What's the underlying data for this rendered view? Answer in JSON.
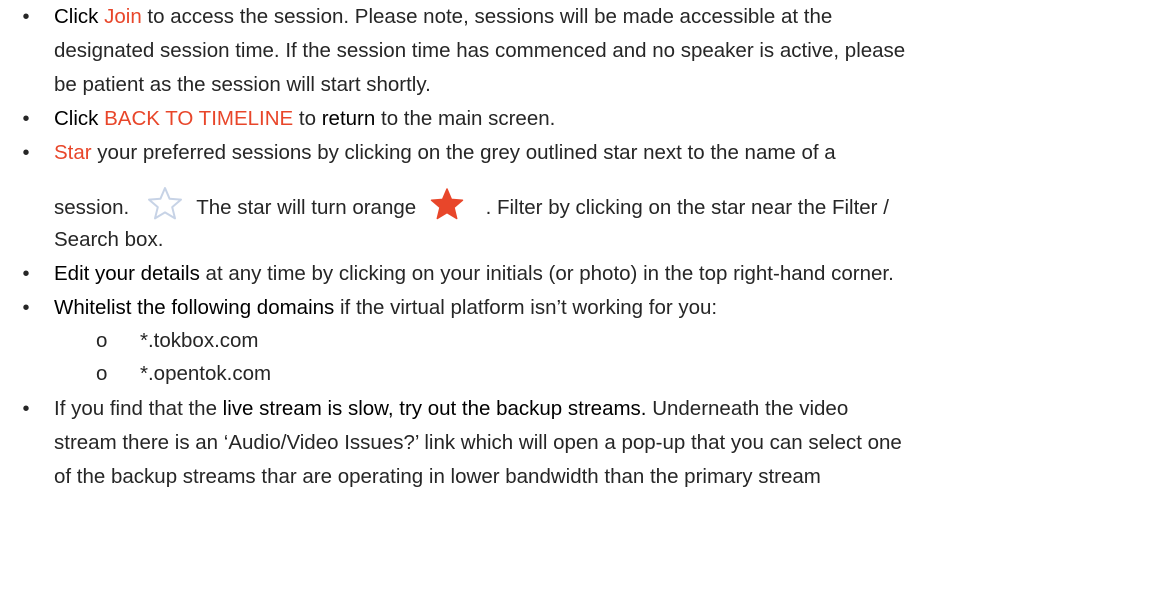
{
  "bullets": [
    {
      "lines": [
        [
          {
            "t": "Click ",
            "s": "b"
          },
          {
            "t": "Join",
            "s": "r"
          },
          {
            "t": " to access the session. Please note, sessions will be made accessible at the",
            "s": ""
          }
        ],
        [
          {
            "t": "designated session time. If the session time has commenced and no speaker is active, please",
            "s": ""
          }
        ],
        [
          {
            "t": "be patient as the session will start shortly.",
            "s": ""
          }
        ]
      ]
    },
    {
      "lines": [
        [
          {
            "t": "Click ",
            "s": "b"
          },
          {
            "t": "BACK TO TIMELINE",
            "s": "r"
          },
          {
            "t": " to ",
            "s": ""
          },
          {
            "t": "return",
            "s": "b"
          },
          {
            "t": " to the main screen.",
            "s": ""
          }
        ]
      ]
    },
    {
      "line1": [
        {
          "t": "Star",
          "s": "r"
        },
        {
          "t": " your preferred sessions by clicking on the grey outlined star next to the name of a",
          "s": ""
        }
      ],
      "line2a": "session.",
      "line2b": "The star will turn orange",
      "line2c": ". Filter by clicking on the star near the Filter /",
      "line3": "Search box."
    },
    {
      "lines": [
        [
          {
            "t": "Edit your details",
            "s": "b"
          },
          {
            "t": " at any time by clicking on your initials (or photo) in the top right-hand corner.",
            "s": ""
          }
        ]
      ]
    },
    {
      "lines": [
        [
          {
            "t": "Whitelist the following domains",
            "s": "b"
          },
          {
            "t": " if the virtual platform isn’t working for you:",
            "s": ""
          }
        ]
      ]
    },
    {
      "lines": [
        [
          {
            "t": "If you find that the ",
            "s": ""
          },
          {
            "t": "live stream is slow, try out the backup streams.",
            "s": "b"
          },
          {
            "t": " Underneath the video",
            "s": ""
          }
        ],
        [
          {
            "t": "stream there is an ‘Audio/Video Issues?’ link which will open a pop-up that you can select one",
            "s": ""
          }
        ],
        [
          {
            "t": "of the backup streams thar are operating in lower bandwidth than the primary stream",
            "s": ""
          }
        ]
      ]
    }
  ],
  "subitems": [
    "*.tokbox.com",
    "*.opentok.com"
  ],
  "bullet_glyph": "•",
  "sub_glyph": "o",
  "colors": {
    "accent": "#e8462a",
    "star_outline": "#c7d3e6",
    "star_filled": "#e8462a"
  }
}
